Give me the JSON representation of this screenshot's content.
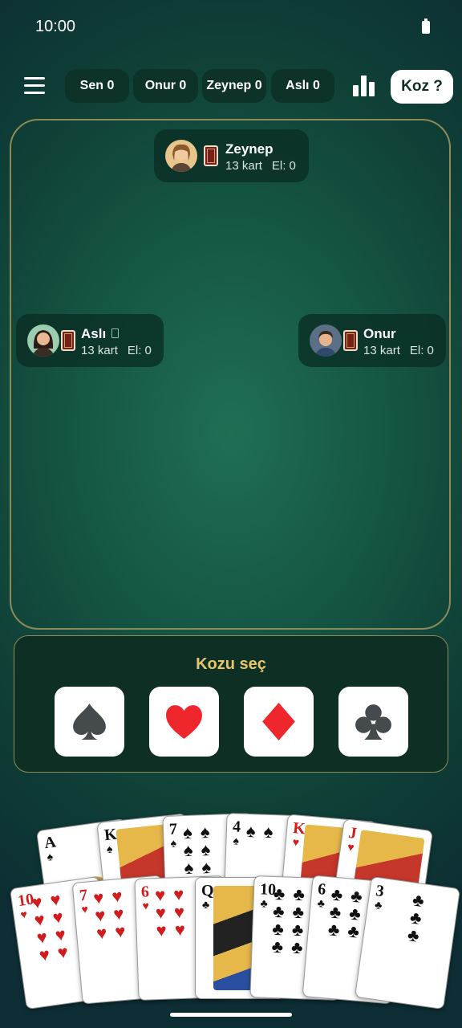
{
  "status": {
    "time": "10:00"
  },
  "scores": [
    {
      "label": "Sen 0"
    },
    {
      "label": "Onur 0"
    },
    {
      "label": "Zeynep 0"
    },
    {
      "label": "Aslı 0"
    }
  ],
  "koz_button": "Koz ?",
  "players": {
    "top": {
      "name": "Zeynep",
      "cards": "13 kart",
      "el": "El: 0"
    },
    "left": {
      "name": "Aslı",
      "cards": "13 kart",
      "el": "El: 0"
    },
    "right": {
      "name": "Onur",
      "cards": "13 kart",
      "el": "El: 0"
    }
  },
  "trump_panel": {
    "title": "Kozu seç",
    "suits": [
      "spade",
      "heart",
      "diamond",
      "club"
    ]
  },
  "hand": {
    "back_row": [
      {
        "rank": "A",
        "suit": "♠",
        "color": "black"
      },
      {
        "rank": "K",
        "suit": "♠",
        "color": "black"
      },
      {
        "rank": "7",
        "suit": "♠",
        "color": "black"
      },
      {
        "rank": "4",
        "suit": "♠",
        "color": "black"
      },
      {
        "rank": "K",
        "suit": "♥",
        "color": "red"
      },
      {
        "rank": "J",
        "suit": "♥",
        "color": "red"
      }
    ],
    "front_row": [
      {
        "rank": "10",
        "suit": "♥",
        "color": "red"
      },
      {
        "rank": "7",
        "suit": "♥",
        "color": "red"
      },
      {
        "rank": "6",
        "suit": "♥",
        "color": "red"
      },
      {
        "rank": "Q",
        "suit": "♣",
        "color": "black"
      },
      {
        "rank": "10",
        "suit": "♣",
        "color": "black"
      },
      {
        "rank": "6",
        "suit": "♣",
        "color": "black"
      },
      {
        "rank": "3",
        "suit": "♣",
        "color": "black"
      }
    ]
  },
  "colors": {
    "accent_gold": "#e9c56a",
    "felt": "#1f6f55",
    "border": "#8d8a5a"
  }
}
